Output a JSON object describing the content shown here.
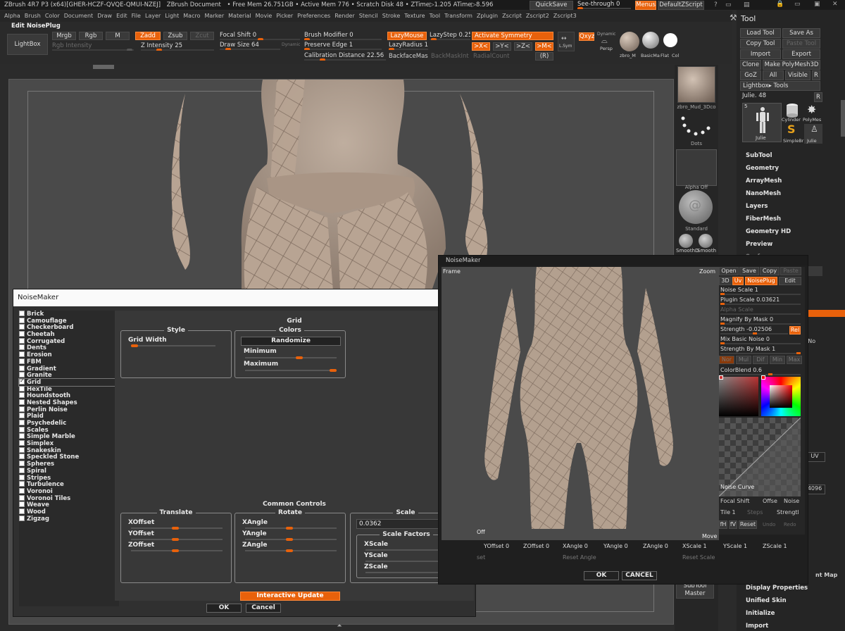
{
  "title": {
    "app": "ZBrush 4R7 P3 (x64)[GHER-HCZF-QVQE-QMUI-NZEJ]",
    "doc": "ZBrush Document",
    "stats": "• Free Mem 26.751GB • Active Mem 776 • Scratch Disk 48 • ZTime▷1.205 ATime▷8.596",
    "quicksave": "QuickSave",
    "see_through": "See-through  0",
    "menus": "Menus",
    "script": "DefaultZScript"
  },
  "menubar": [
    "Alpha",
    "Brush",
    "Color",
    "Document",
    "Draw",
    "Edit",
    "File",
    "Layer",
    "Light",
    "Macro",
    "Marker",
    "Material",
    "Movie",
    "Picker",
    "Preferences",
    "Render",
    "Stencil",
    "Stroke",
    "Texture",
    "Tool",
    "Transform",
    "Zplugin",
    "Zscript",
    "Zscript2",
    "Zscript3"
  ],
  "toolbar": {
    "edit_label": "Edit NoisePlug",
    "lightbox": "LightBox",
    "mrgb": "Mrgb",
    "rgb": "Rgb",
    "m": "M",
    "zadd": "Zadd",
    "zsub": "Zsub",
    "zcut": "Zcut",
    "rgb_intensity": "Rgb Intensity",
    "z_intensity": "Z Intensity 25",
    "focal_shift": "Focal Shift 0",
    "draw_size": "Draw Size 64",
    "dynamic": "Dynamic",
    "brush_modifier": "Brush Modifier 0",
    "preserve_edge": "Preserve Edge 1",
    "calibration": "Calibration Distance 22.56",
    "lazymouse": "LazyMouse",
    "lazystep": "LazyStep 0.25",
    "lazyradius": "LazyRadius 1",
    "backfacemas": "BackfaceMas",
    "backmaskint": "BackMaskInt",
    "radialcount": "RadialCount",
    "activate_symmetry": "Activate Symmetry",
    "sym_x": ">X<",
    "sym_y": ">Y<",
    "sym_z": ">Z<",
    "sym_m": ">M<",
    "sym_r": "(R)",
    "lsym": "L.Sym",
    "qxyz": "Qxyz",
    "persp": "Persp",
    "dynamic2": "Dynamic",
    "mat1": "zbro_M",
    "mat2": "BasicMa",
    "mat3": "Flat",
    "mat4": "Col"
  },
  "tray": {
    "material": "zbro_Mud_3Dco",
    "dots": "Dots",
    "alpha": "Alpha Off",
    "standard": "Standard",
    "smooth1": "SmoothD",
    "smooth2": "Smooth",
    "subtool_master": "SubTool Master"
  },
  "toolpanel": {
    "title": "Tool",
    "load": "Load Tool",
    "save_as": "Save As",
    "copy": "Copy Tool",
    "paste": "Paste Tool",
    "import": "Import",
    "export": "Export",
    "clone": "Clone",
    "make": "Make PolyMesh3D",
    "goz": "GoZ",
    "all": "All",
    "visible": "Visible",
    "r": "R",
    "lightbox_tools": "Lightbox▸ Tools",
    "julie": "Julie. 48",
    "r2": "R",
    "thumb_count": "5",
    "thumbs": [
      "Julie",
      "Cylinder",
      "PolyMes",
      "SimpleBr",
      "Julie"
    ],
    "items": [
      "SubTool",
      "Geometry",
      "ArrayMesh",
      "NanoMesh",
      "Layers",
      "FiberMesh",
      "Geometry HD",
      "Preview",
      "Surface"
    ],
    "bottom": [
      "Display Properties",
      "Unified Skin",
      "Initialize",
      "Import"
    ],
    "partial": [
      "ckByNo",
      "UV",
      "4096",
      "nt Map"
    ]
  },
  "noisemaker": {
    "title": "NoiseMaker",
    "list": [
      "Brick",
      "Camouflage",
      "Checkerboard",
      "Cheetah",
      "Corrugated",
      "Dents",
      "Erosion",
      "FBM",
      "Gradient",
      "Granite",
      "Grid",
      "HexTile",
      "Houndstooth",
      "Nested Shapes",
      "Perlin Noise",
      "Plaid",
      "Psychedelic",
      "Scales",
      "Simple Marble",
      "Simplex",
      "Snakeskin",
      "Speckled Stone",
      "Spheres",
      "Spiral",
      "Stripes",
      "Turbulence",
      "Voronoi",
      "Voronoi Tiles",
      "Weave",
      "Wood",
      "Zigzag"
    ],
    "selected": "Grid",
    "section_title": "Grid",
    "style_title": "Style",
    "grid_width": "Grid Width",
    "colors_title": "Colors",
    "randomize": "Randomize",
    "minimum": "Minimum",
    "maximum": "Maximum",
    "common_controls": "Common Controls",
    "translate_title": "Translate",
    "xoffset": "XOffset",
    "yoffset": "YOffset",
    "zoffset": "ZOffset",
    "rotate_title": "Rotate",
    "xangle": "XAngle",
    "yangle": "YAngle",
    "zangle": "ZAngle",
    "scale_title": "Scale",
    "scale_value": "0.0362",
    "scale_factors": "Scale Factors",
    "xscale": "XScale",
    "yscale": "YScale",
    "zscale": "ZScale",
    "interactive_update": "Interactive Update",
    "ok": "OK",
    "cancel": "Cancel"
  },
  "noiseplug": {
    "title": "NoiseMaker",
    "frame": "Frame",
    "zoom": "Zoom",
    "open": "Open",
    "save": "Save",
    "copy": "Copy",
    "paste": "Paste",
    "d3": "3D",
    "uv": "Uv",
    "noiseplug": "NoisePlug",
    "edit": "Edit",
    "noise_scale": "Noise Scale  1",
    "plugin_scale": "Plugin Scale  0.03621",
    "alpha_scale": "Alpha Scale",
    "magnify": "Magnify By Mask 0",
    "strength": "Strength -0.02506",
    "rel": "Rel",
    "mix_basic": "Mix Basic Noise 0",
    "strength_mask": "Strength By Mask 1",
    "modes": [
      "Nor",
      "Mul",
      "Dif",
      "Min",
      "Max"
    ],
    "colorblend": "ColorBlend 0.6",
    "noise_curve": "Noise Curve",
    "focal_shift": "Focal Shift",
    "offset": "Offse",
    "noise": "Noise",
    "tile": "Tile 1",
    "steps": "Steps",
    "strength2": "Strengtl",
    "fh": "fH",
    "fv": "fV",
    "reset": "Reset",
    "undo": "Undo",
    "redo": "Redo",
    "off": "Off",
    "move": "Move",
    "yoffset": "YOffset 0",
    "zoffset": "ZOffset 0",
    "xangle": "XAngle 0",
    "yangle": "YAngle 0",
    "zangle": "ZAngle 0",
    "xscale": "XScale 1",
    "yscale": "YScale 1",
    "zscale": "ZScale 1",
    "reset_offset": "set",
    "reset_angle": "Reset Angle",
    "reset_scale": "Reset Scale",
    "ok": "OK",
    "cancel": "CANCEL"
  },
  "colors": {
    "accent": "#e8610b",
    "skin": "#b8a493",
    "viewport": "#4a4a4a"
  }
}
